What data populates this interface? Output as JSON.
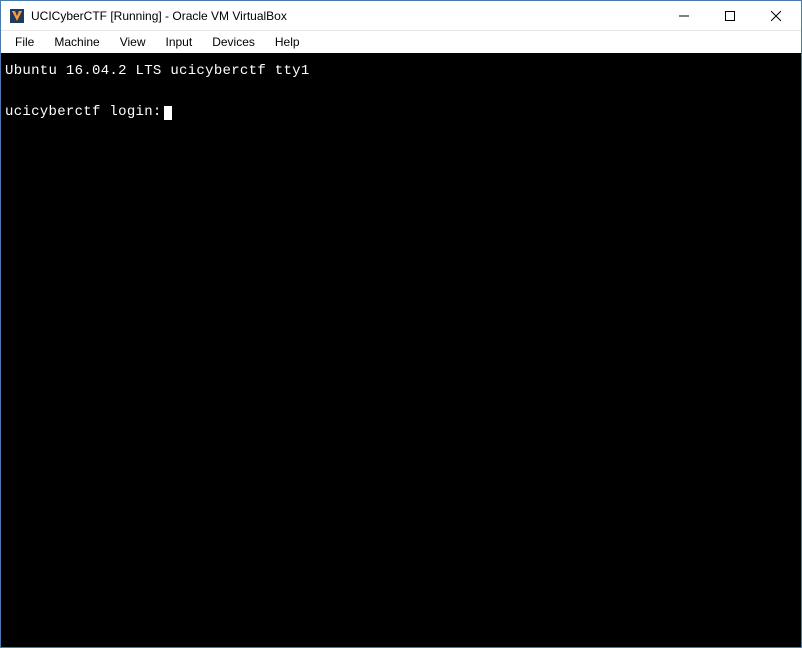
{
  "window": {
    "title": "UCICyberCTF [Running] - Oracle VM VirtualBox"
  },
  "menubar": {
    "items": [
      {
        "label": "File"
      },
      {
        "label": "Machine"
      },
      {
        "label": "View"
      },
      {
        "label": "Input"
      },
      {
        "label": "Devices"
      },
      {
        "label": "Help"
      }
    ]
  },
  "terminal": {
    "line1": "Ubuntu 16.04.2 LTS ucicyberctf tty1",
    "line2": "ucicyberctf login:"
  }
}
